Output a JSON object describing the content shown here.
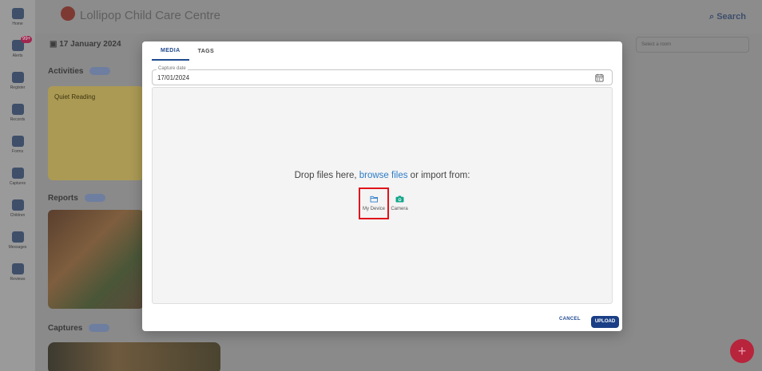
{
  "app": {
    "title": "Lollipop Child Care Centre",
    "search_label": "Search",
    "date_label": "17 January 2024",
    "select_placeholder": "Select a room",
    "sections": {
      "activities": "Activities",
      "reports": "Reports",
      "captures": "Captures"
    },
    "card_title": "Quiet Reading",
    "fab_symbol": "+"
  },
  "sidebar": {
    "items": [
      {
        "label": "Home",
        "icon": "home-icon"
      },
      {
        "label": "Alerts",
        "icon": "bell-icon",
        "badge": "99+"
      },
      {
        "label": "Register",
        "icon": "calendar-icon"
      },
      {
        "label": "Records",
        "icon": "document-icon"
      },
      {
        "label": "Forms",
        "icon": "form-icon"
      },
      {
        "label": "Captures",
        "icon": "image-icon"
      },
      {
        "label": "Children",
        "icon": "child-icon"
      },
      {
        "label": "Messages",
        "icon": "message-icon"
      },
      {
        "label": "Reviews",
        "icon": "review-icon"
      }
    ]
  },
  "modal": {
    "tabs": [
      {
        "label": "MEDIA"
      },
      {
        "label": "TAGS"
      }
    ],
    "capture_date": {
      "label": "Capture date",
      "value": "17/01/2024"
    },
    "drop": {
      "prefix": "Drop files here,",
      "link": "browse files",
      "suffix": "or import from:"
    },
    "sources": [
      {
        "label": "My Device",
        "icon": "folder-icon"
      },
      {
        "label": "Camera",
        "icon": "camera-icon"
      }
    ],
    "cancel_label": "CANCEL",
    "upload_label": "UPLOAD"
  },
  "colors": {
    "primary": "#1a3f86",
    "link": "#2d7bc7",
    "camera_green": "#13a58a",
    "highlight_red": "#e0131a"
  }
}
